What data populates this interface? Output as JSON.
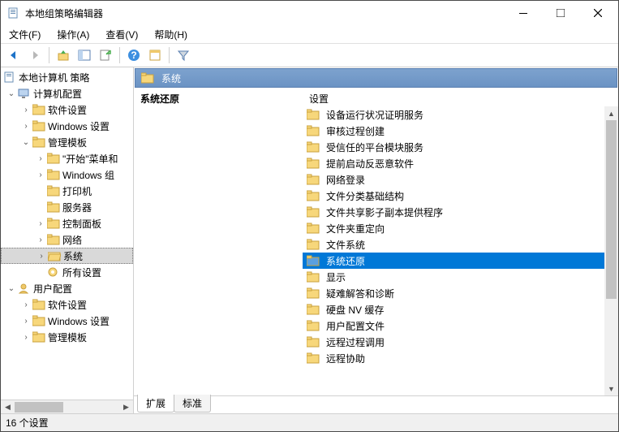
{
  "window": {
    "title": "本地组策略编辑器"
  },
  "menu": {
    "file": "文件(F)",
    "action": "操作(A)",
    "view": "查看(V)",
    "help": "帮助(H)"
  },
  "tree": {
    "root": "本地计算机 策略",
    "computer_config": "计算机配置",
    "cc_software": "软件设置",
    "cc_windows": "Windows 设置",
    "cc_templates": "管理模板",
    "t_start": "\"开始\"菜单和",
    "t_wincomp": "Windows 组",
    "t_printer": "打印机",
    "t_server": "服务器",
    "t_control": "控制面板",
    "t_network": "网络",
    "t_system": "系统",
    "t_all": "所有设置",
    "user_config": "用户配置",
    "uc_software": "软件设置",
    "uc_windows": "Windows 设置",
    "uc_templates": "管理模板"
  },
  "header": {
    "title": "系统"
  },
  "columns": {
    "left": "系统还原",
    "right": "设置"
  },
  "items": [
    "设备运行状况证明服务",
    "审核过程创建",
    "受信任的平台模块服务",
    "提前启动反恶意软件",
    "网络登录",
    "文件分类基础结构",
    "文件共享影子副本提供程序",
    "文件夹重定向",
    "文件系统",
    "系统还原",
    "显示",
    "疑难解答和诊断",
    "硬盘 NV 缓存",
    "用户配置文件",
    "远程过程调用",
    "远程协助"
  ],
  "selected_item_index": 9,
  "tabs": {
    "extended": "扩展",
    "standard": "标准"
  },
  "status": "16 个设置"
}
